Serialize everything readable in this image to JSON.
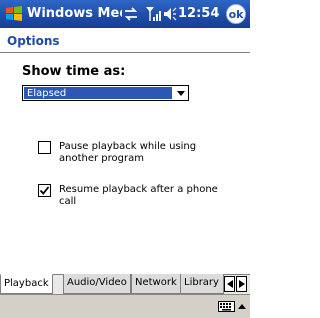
{
  "titlebar": {
    "app_title": "Windows Medi",
    "time": "12:54",
    "ok_label": "ok",
    "icons": [
      "windows-logo-icon",
      "sync-icon",
      "signal-icon",
      "volume-icon"
    ]
  },
  "page": {
    "title": "Options"
  },
  "show_time": {
    "label": "Show time as:",
    "selected": "Elapsed"
  },
  "options": [
    {
      "label": "Pause playback while using another program",
      "checked": false
    },
    {
      "label": "Resume playback after a phone call",
      "checked": true
    }
  ],
  "tabs": [
    {
      "label": "Playback",
      "active": true
    },
    {
      "label": "Audio/Video",
      "active": false
    },
    {
      "label": "Network",
      "active": false
    },
    {
      "label": "Library",
      "active": false
    }
  ],
  "colors": {
    "titlebar": "#1d4ba8",
    "accent": "#2c57b5",
    "commandbar": "#d4d0c8"
  }
}
